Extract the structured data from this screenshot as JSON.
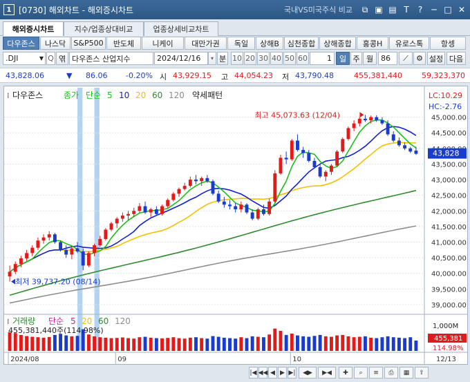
{
  "window": {
    "title": "[0730] 해외차트 - 해외증시차트",
    "compare_link": "국내VS미국주식 비교",
    "icon_label": "1"
  },
  "tabs": [
    {
      "label": "해외증시차트",
      "active": true
    },
    {
      "label": "지수/업종상대비교",
      "active": false
    },
    {
      "label": "업종상세비교차트",
      "active": false
    }
  ],
  "market_buttons": [
    "다우존스",
    "나스닥",
    "S&P500",
    "반도체",
    "니케이",
    "대만가권",
    "독일",
    "상해B",
    "심천종합",
    "상해종합",
    "홍콩H",
    "유로스톡",
    "항셍"
  ],
  "symbol": {
    "code": ".DJI",
    "name": "다우존스 산업지수",
    "date": "2024/12/16",
    "period_label": "분",
    "min_options": [
      "10",
      "20",
      "30",
      "40",
      "50",
      "60"
    ],
    "tick_value": "1",
    "day_label": "일",
    "week_label": "주",
    "month_label": "월",
    "count": "86",
    "settings_label": "설정",
    "next_label": "다음",
    "ref_label": "엮"
  },
  "quote": {
    "price": "43,828.06",
    "change_arrow": "▼",
    "change": "86.06",
    "change_pct": "-0.20%",
    "open_label": "시",
    "open": "43,929.15",
    "high_label": "고",
    "high": "44,054.23",
    "low_label": "저",
    "low": "43,790.48",
    "volume": "455,381,440",
    "amount": "59,323,370"
  },
  "chart": {
    "legend_name": "다우존스",
    "legend_price": "종가",
    "legend_ma": "단순",
    "ma_periods": [
      "5",
      "10",
      "20",
      "60",
      "120"
    ],
    "pattern_label": "약세패턴",
    "lc_label": "LC:10.29",
    "hc_label": "HC:-2.76",
    "current_price_label": "43,828",
    "max_annotation": "최고 45,073.63 (12/04)",
    "min_annotation": "최저 39,737.20 (08/14)",
    "colors": {
      "up": "#e21a1a",
      "down": "#1a3ccd",
      "ma5": "#18c018",
      "ma10": "#1020d0",
      "ma20": "#f6c000",
      "ma60": "#2e8b2e",
      "ma120": "#8c8c8c",
      "highlight": "#7fb7e6"
    },
    "y_ticks": [
      "45,000.00",
      "44,500.00",
      "44,000.00",
      "43,500.00",
      "43,000.00",
      "42,500.00",
      "42,000.00",
      "41,500.00",
      "41,000.00",
      "40,500.00",
      "40,000.00",
      "39,500.00",
      "39,000.00"
    ],
    "x_ticks": [
      "2024/08",
      "09",
      "10",
      "11",
      "12",
      "12/13"
    ]
  },
  "volume_panel": {
    "legend_name": "거래량",
    "legend_ma": "단순",
    "ma_periods": [
      "5",
      "20",
      "60",
      "120"
    ],
    "value_label": "455,381,440주(114.98%)",
    "axis_label": "1,000M",
    "current_label": "455,381",
    "pct_label": "114.98%"
  },
  "chart_data": {
    "type": "candlestick",
    "title": "다우존스",
    "xlabel": "",
    "ylabel": "",
    "ylim": [
      38800,
      45500
    ],
    "x_range": [
      "2024/08",
      "2024/12/16"
    ],
    "ohlc": [
      [
        39900,
        40250,
        39737,
        40050
      ],
      [
        40050,
        40380,
        39980,
        40300
      ],
      [
        40300,
        40560,
        40200,
        40480
      ],
      [
        40480,
        40750,
        40400,
        40650
      ],
      [
        40650,
        40900,
        40550,
        40820
      ],
      [
        40820,
        41150,
        40750,
        41050
      ],
      [
        41050,
        41250,
        40950,
        41150
      ],
      [
        41150,
        41350,
        41050,
        41250
      ],
      [
        41250,
        41300,
        40950,
        41000
      ],
      [
        41000,
        41050,
        40700,
        40750
      ],
      [
        40750,
        40900,
        40500,
        40600
      ],
      [
        40600,
        40850,
        40450,
        40800
      ],
      [
        40800,
        41000,
        40650,
        40700
      ],
      [
        40700,
        40800,
        40100,
        40250
      ],
      [
        40250,
        40700,
        40200,
        40650
      ],
      [
        40650,
        40950,
        40550,
        40900
      ],
      [
        40900,
        41200,
        40850,
        41100
      ],
      [
        41100,
        41450,
        41050,
        41400
      ],
      [
        41400,
        41650,
        41350,
        41600
      ],
      [
        41600,
        41800,
        41450,
        41750
      ],
      [
        41750,
        41950,
        41650,
        41850
      ],
      [
        41850,
        42000,
        41700,
        41900
      ],
      [
        41900,
        42100,
        41800,
        42000
      ],
      [
        42000,
        42250,
        41950,
        42150
      ],
      [
        42150,
        42300,
        41900,
        41950
      ],
      [
        41950,
        42100,
        41800,
        42050
      ],
      [
        42050,
        42150,
        41850,
        41900
      ],
      [
        41900,
        42200,
        41850,
        42150
      ],
      [
        42150,
        42400,
        42100,
        42350
      ],
      [
        42350,
        42600,
        42300,
        42550
      ],
      [
        42550,
        42750,
        42450,
        42700
      ],
      [
        42700,
        42900,
        42650,
        42800
      ],
      [
        42800,
        43100,
        42750,
        43000
      ],
      [
        43000,
        43150,
        42850,
        42950
      ],
      [
        42950,
        43100,
        42800,
        43050
      ],
      [
        43050,
        43150,
        42900,
        42950
      ],
      [
        42950,
        43000,
        42500,
        42550
      ],
      [
        42550,
        42650,
        42250,
        42300
      ],
      [
        42300,
        42450,
        42100,
        42200
      ],
      [
        42200,
        42350,
        42050,
        42150
      ],
      [
        42150,
        42250,
        41950,
        42050
      ],
      [
        42050,
        42300,
        41950,
        42200
      ],
      [
        42200,
        42250,
        41900,
        41950
      ],
      [
        41950,
        42050,
        41700,
        41750
      ],
      [
        41750,
        42100,
        41700,
        42050
      ],
      [
        42050,
        42200,
        41850,
        41900
      ],
      [
        41900,
        42400,
        41850,
        42300
      ],
      [
        42300,
        43300,
        42250,
        43200
      ],
      [
        43200,
        43800,
        43150,
        43700
      ],
      [
        43700,
        43900,
        43500,
        43650
      ],
      [
        43650,
        44300,
        43600,
        44250
      ],
      [
        44250,
        44450,
        43900,
        43950
      ],
      [
        43950,
        44050,
        43700,
        43850
      ],
      [
        43850,
        43950,
        43550,
        43600
      ],
      [
        43600,
        43700,
        43350,
        43400
      ],
      [
        43400,
        43500,
        43050,
        43100
      ],
      [
        43100,
        43300,
        42950,
        43250
      ],
      [
        43250,
        43500,
        43150,
        43450
      ],
      [
        43450,
        43950,
        43400,
        43900
      ],
      [
        43900,
        44350,
        43850,
        44300
      ],
      [
        44300,
        44700,
        44250,
        44650
      ],
      [
        44650,
        44900,
        44550,
        44800
      ],
      [
        44800,
        45000,
        44700,
        44950
      ],
      [
        44950,
        45073,
        44850,
        44900
      ],
      [
        44900,
        45050,
        44800,
        45000
      ],
      [
        45000,
        45060,
        44850,
        44900
      ],
      [
        44900,
        45000,
        44750,
        44800
      ],
      [
        44800,
        44900,
        44400,
        44450
      ],
      [
        44450,
        44550,
        44200,
        44250
      ],
      [
        44250,
        44350,
        44050,
        44100
      ],
      [
        44100,
        44200,
        43950,
        44000
      ],
      [
        44000,
        44050,
        43850,
        43900
      ],
      [
        43929,
        44054,
        43790,
        43828
      ]
    ],
    "volume": [
      820,
      780,
      700,
      650,
      620,
      600,
      580,
      610,
      700,
      750,
      680,
      640,
      660,
      950,
      720,
      640,
      600,
      580,
      560,
      570,
      590,
      560,
      540,
      600,
      620,
      580,
      560,
      550,
      570,
      600,
      560,
      540,
      580,
      600,
      560,
      540,
      650,
      620,
      580,
      560,
      540,
      600,
      560,
      640,
      620,
      600,
      720,
      980,
      880,
      700,
      760,
      680,
      640,
      620,
      660,
      700,
      640,
      620,
      680,
      700,
      640,
      600,
      620,
      640,
      580,
      560,
      600,
      640,
      600,
      580,
      560,
      600,
      455
    ]
  }
}
